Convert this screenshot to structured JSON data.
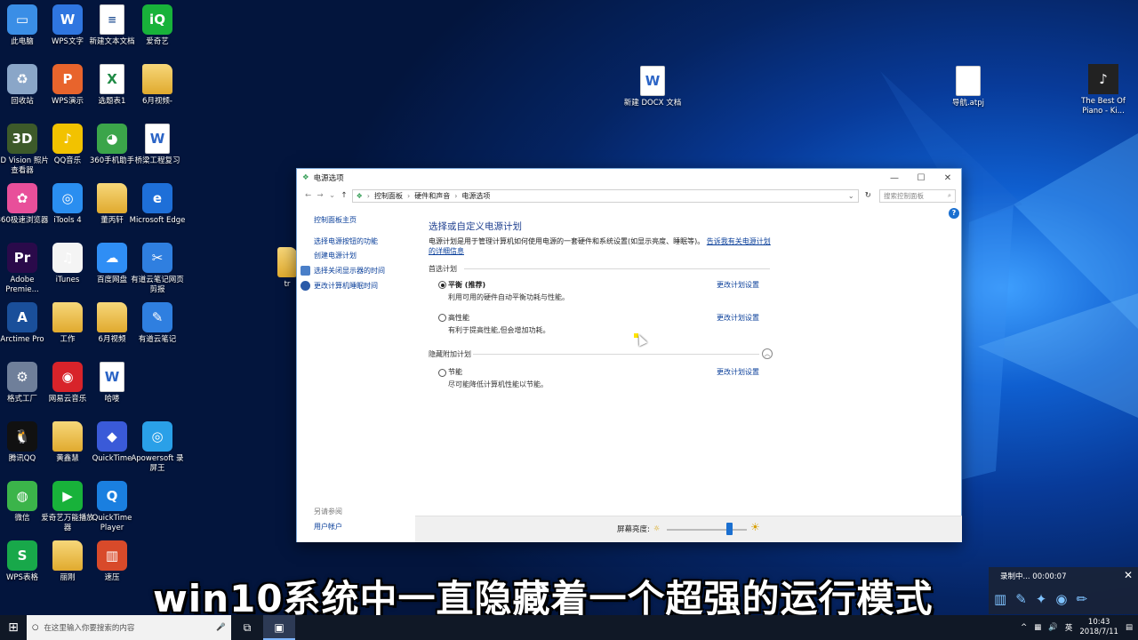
{
  "desktop": {
    "icons": [
      {
        "label": "此电脑",
        "icon": "computer-icon",
        "glyph": "▭",
        "color": "#3a8ee6"
      },
      {
        "label": "WPS文字",
        "icon": "wps-writer-icon",
        "glyph": "W",
        "color": "#2f76e0"
      },
      {
        "label": "新建文本文档",
        "icon": "text-document-icon",
        "glyph": "≡",
        "color": "#ffffff"
      },
      {
        "label": "爱奇艺",
        "icon": "iqiyi-icon",
        "glyph": "iQ",
        "color": "#18b23a"
      },
      {
        "label": "回收站",
        "icon": "recycle-bin-icon",
        "glyph": "♻",
        "color": "#8aa6c8"
      },
      {
        "label": "WPS演示",
        "icon": "wps-presentation-icon",
        "glyph": "P",
        "color": "#e8642c"
      },
      {
        "label": "选题表1",
        "icon": "excel-file-icon",
        "glyph": "X",
        "color": "#ffffff"
      },
      {
        "label": "6月视频-",
        "icon": "folder-icon",
        "glyph": "",
        "color": "#e8b840"
      },
      {
        "label": "3D Vision 照片查看器",
        "icon": "3d-vision-icon",
        "glyph": "3D",
        "color": "#3d5a2a"
      },
      {
        "label": "QQ音乐",
        "icon": "qq-music-icon",
        "glyph": "♪",
        "color": "#f2c200"
      },
      {
        "label": "360手机助手",
        "icon": "360-assistant-icon",
        "glyph": "◕",
        "color": "#3ba54a"
      },
      {
        "label": "桥梁工程复习",
        "icon": "word-document-icon",
        "glyph": "W",
        "color": "#ffffff"
      },
      {
        "label": "360极速浏览器",
        "icon": "360-browser-icon",
        "glyph": "✿",
        "color": "#e84f9a"
      },
      {
        "label": "iTools 4",
        "icon": "itools-icon",
        "glyph": "◎",
        "color": "#2a8ef0"
      },
      {
        "label": "董丙轩",
        "icon": "folder-icon",
        "glyph": "",
        "color": "#e8b840"
      },
      {
        "label": "Microsoft Edge",
        "icon": "edge-icon",
        "glyph": "e",
        "color": "#1e6fd8"
      },
      {
        "label": "Adobe Premie...",
        "icon": "premiere-icon",
        "glyph": "Pr",
        "color": "#2a0a4a"
      },
      {
        "label": "iTunes",
        "icon": "itunes-icon",
        "glyph": "♫",
        "color": "#f4f4f4"
      },
      {
        "label": "百度网盘",
        "icon": "baidu-netdisk-icon",
        "glyph": "☁",
        "color": "#2f8ef5"
      },
      {
        "label": "有道云笔记网页剪报",
        "icon": "youdao-clipper-icon",
        "glyph": "✂",
        "color": "#2f7fe0"
      },
      {
        "label": "Arctime Pro",
        "icon": "arctime-icon",
        "glyph": "A",
        "color": "#1a4f9a"
      },
      {
        "label": "工作",
        "icon": "folder-icon",
        "glyph": "",
        "color": "#e8b840"
      },
      {
        "label": "6月视频",
        "icon": "folder-icon",
        "glyph": "",
        "color": "#e8b840"
      },
      {
        "label": "有道云笔记",
        "icon": "youdao-note-icon",
        "glyph": "✎",
        "color": "#2f7fe0"
      },
      {
        "label": "格式工厂",
        "icon": "format-factory-icon",
        "glyph": "⚙",
        "color": "#6f7f9a"
      },
      {
        "label": "网易云音乐",
        "icon": "netease-music-icon",
        "glyph": "◉",
        "color": "#d8232a"
      },
      {
        "label": "哈喽",
        "icon": "word-document-icon",
        "glyph": "W",
        "color": "#ffffff"
      },
      {
        "label": "",
        "icon": "blank-icon",
        "glyph": "",
        "color": ""
      },
      {
        "label": "腾讯QQ",
        "icon": "qq-icon",
        "glyph": "🐧",
        "color": "#111111"
      },
      {
        "label": "黄鑫慧",
        "icon": "folder-icon",
        "glyph": "",
        "color": "#e8b840"
      },
      {
        "label": "QuickTime",
        "icon": "quicktime-box-icon",
        "glyph": "◆",
        "color": "#3a5ad8"
      },
      {
        "label": "Apowersoft 录屏王",
        "icon": "apowersoft-icon",
        "glyph": "◎",
        "color": "#2aa0e8"
      },
      {
        "label": "微信",
        "icon": "wechat-icon",
        "glyph": "◍",
        "color": "#3bb44a"
      },
      {
        "label": "爱奇艺万能播放器",
        "icon": "iqiyi-player-icon",
        "glyph": "▶",
        "color": "#18b23a"
      },
      {
        "label": "QuickTime Player",
        "icon": "quicktime-player-icon",
        "glyph": "Q",
        "color": "#1a7fe0"
      },
      {
        "label": "",
        "icon": "blank-icon",
        "glyph": "",
        "color": ""
      },
      {
        "label": "WPS表格",
        "icon": "wps-spreadsheet-icon",
        "glyph": "S",
        "color": "#18a84a"
      },
      {
        "label": "丽刚",
        "icon": "folder-icon",
        "glyph": "",
        "color": "#e8b840"
      },
      {
        "label": "速压",
        "icon": "compress-icon",
        "glyph": "▥",
        "color": "#d84a2a"
      }
    ],
    "floating": [
      {
        "label": "新建 DOCX 文档",
        "icon": "docx-file-icon"
      },
      {
        "label": "导航.atpj",
        "icon": "atpj-file-icon"
      },
      {
        "label": "The Best Of Piano - Ki...",
        "icon": "album-file-icon"
      }
    ],
    "partial_label": "tr"
  },
  "window": {
    "title": "电源选项",
    "address": [
      "控制面板",
      "硬件和声音",
      "电源选项"
    ],
    "search_placeholder": "搜索控制面板",
    "sidebar": {
      "home": "控制面板主页",
      "links": [
        "选择电源按钮的功能",
        "创建电源计划",
        "选择关闭显示器的时间",
        "更改计算机睡眠时间"
      ],
      "see_also": "另请参阅",
      "user_accounts": "用户帐户"
    },
    "main": {
      "heading": "选择或自定义电源计划",
      "description": "电源计划是用于管理计算机如何使用电源的一套硬件和系统设置(如显示亮度、睡眠等)。",
      "description_link": "告诉我有关电源计划的详细信息",
      "preferred_group": "首选计划",
      "hidden_group": "隐藏附加计划",
      "change_link": "更改计划设置",
      "plans": [
        {
          "name": "平衡 (推荐)",
          "desc": "利用可用的硬件自动平衡功耗与性能。",
          "selected": true
        },
        {
          "name": "高性能",
          "desc": "有利于提高性能,但会增加功耗。",
          "selected": false
        },
        {
          "name": "节能",
          "desc": "尽可能降低计算机性能以节能。",
          "selected": false
        }
      ]
    },
    "brightness_label": "屏幕亮度:",
    "brightness_level": 0.78
  },
  "recording": {
    "status": "录制中... 00:00:07"
  },
  "caption": "win10系统中一直隐藏着一个超强的运行模式",
  "taskbar": {
    "search_placeholder": "在这里输入你要搜索的内容",
    "time": "10:43",
    "date": "2018/7/11",
    "ime": "英"
  }
}
